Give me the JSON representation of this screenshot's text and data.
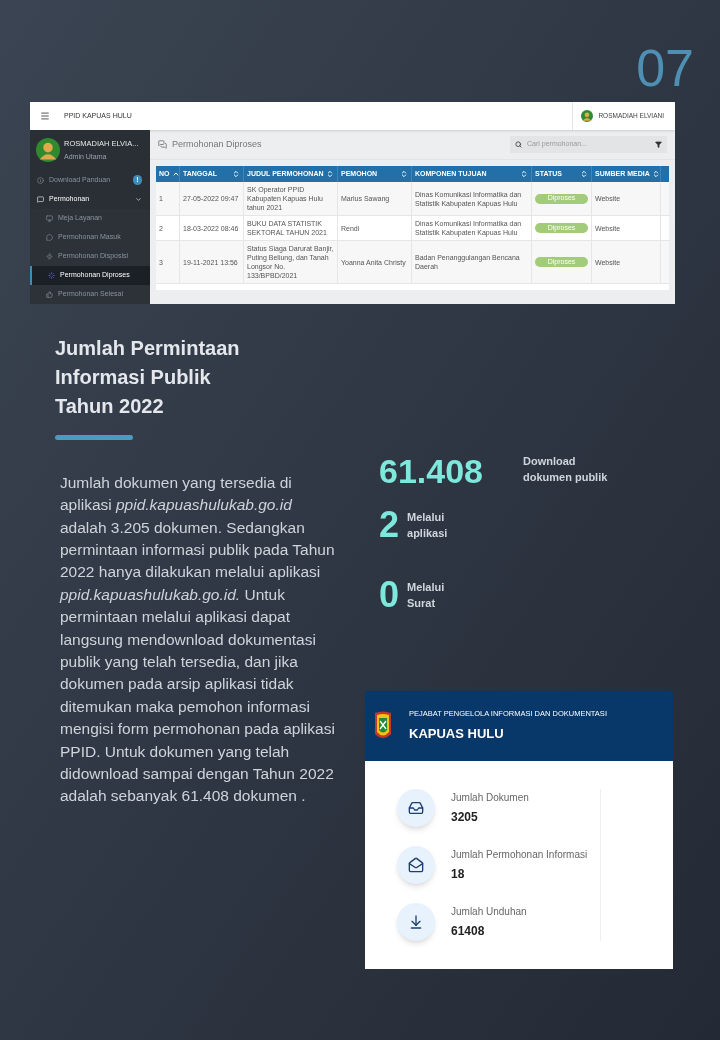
{
  "slide_number": "07",
  "screenshot": {
    "topbar": {
      "title": "PPID KAPUAS HULU",
      "user": "ROSMADIAH ELVIANI"
    },
    "sidebar": {
      "user_name": "ROSMADIAH ELVIA...",
      "role": "Admin Utama",
      "items": [
        {
          "label": "Download Panduan",
          "badge": "!",
          "selected": false
        },
        {
          "label": "Permohonan",
          "expanded": true,
          "selected": false,
          "children": [
            {
              "label": "Meja Layanan",
              "selected": false
            },
            {
              "label": "Permohonan Masuk",
              "selected": false
            },
            {
              "label": "Permohonan Disposisi",
              "selected": false
            },
            {
              "label": "Permohonan Diproses",
              "selected": true
            },
            {
              "label": "Permohonan Selesai",
              "selected": false
            }
          ]
        }
      ]
    },
    "page_title": "Permohonan Diproses",
    "search": {
      "placeholder": "Cari permohonan..."
    },
    "table": {
      "columns": [
        {
          "label": "NO",
          "sorted": true
        },
        {
          "label": "TANGGAL",
          "sorted": false
        },
        {
          "label": "JUDUL PERMOHONAN",
          "sorted": false
        },
        {
          "label": "PEMOHON",
          "sorted": false
        },
        {
          "label": "KOMPONEN TUJUAN",
          "sorted": false
        },
        {
          "label": "STATUS",
          "sorted": false
        },
        {
          "label": "SUMBER MEDIA",
          "sorted": false
        }
      ],
      "rows": [
        {
          "no": "1",
          "tanggal": "27-05-2022 09:47",
          "judul": "SK Operator PPID Kabupaten Kapuas Hulu tahun 2021",
          "pemohon": "Marius Sawang",
          "komponen": "Dinas Komunikasi Informatika dan Statistik Kabupaten Kapuas Hulu",
          "status": "Diproses",
          "sumber": "Website"
        },
        {
          "no": "2",
          "tanggal": "18-03-2022 08:46",
          "judul": "BUKU DATA STATISTIK SEKTORAL TAHUN 2021",
          "pemohon": "Rendi",
          "komponen": "Dinas Komunikasi Informatika dan Statistik Kabupaten Kapuas Hulu",
          "status": "Diproses",
          "sumber": "Website"
        },
        {
          "no": "3",
          "tanggal": "19-11-2021 13:56",
          "judul": "Status Siaga Darurat Banjir, Puting Beliung, dan Tanah Longsor No. 133/BPBD/2021",
          "pemohon": "Yoanna Anita Christy",
          "komponen": "Badan Penanggulangan Bencana Daerah",
          "status": "Diproses",
          "sumber": "Website"
        }
      ]
    }
  },
  "heading": [
    "Jumlah Permintaan",
    "Informasi Publik",
    "Tahun 2022"
  ],
  "paragraph": "Jumlah dokumen yang tersedia di aplikasi *ppid.kapuashulukab.go.id* adalah 3.205 dokumen. Sedangkan permintaan informasi publik pada Tahun 2022 hanya dilakukan melalui aplikasi *ppid.kapuashulukab.go.id.* Untuk permintaan melalui aplikasi dapat langsung mendownload dokumentasi publik yang telah tersedia, dan jika dokumen pada arsip aplikasi tidak ditemukan maka pemohon informasi mengisi form permohonan pada aplikasi PPID. Untuk dokumen yang telah didownload sampai dengan Tahun 2022 adalah sebanyak 61.408 dokumen .",
  "stats": [
    {
      "value": "61.408",
      "label": "Download dokumen publik"
    },
    {
      "value": "2",
      "label": "Melalui aplikasi"
    },
    {
      "value": "0",
      "label": "Melalui Surat"
    }
  ],
  "card": {
    "subtitle": "PEJABAT PENGELOLA INFORMASI DAN DOKUMENTASI",
    "title": "KAPUAS HULU",
    "items": [
      {
        "label": "Jumlah Dokumen",
        "value": "3205"
      },
      {
        "label": "Jumlah Permohonan Informasi",
        "value": "18"
      },
      {
        "label": "Jumlah Unduhan",
        "value": "61408"
      }
    ]
  }
}
